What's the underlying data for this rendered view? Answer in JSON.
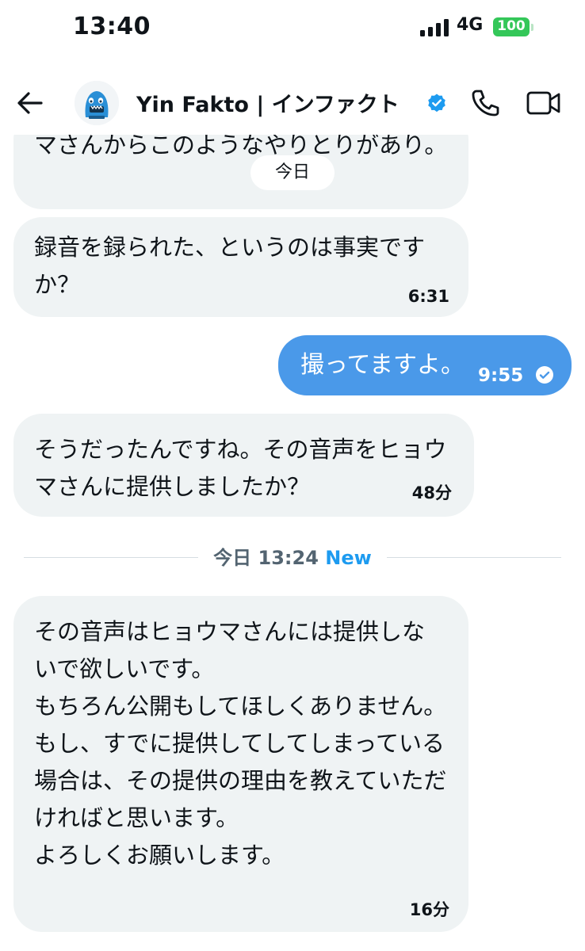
{
  "status_bar": {
    "time": "13:40",
    "network": "4G",
    "battery": "100"
  },
  "header": {
    "contact_name": "Yin Fakto | インファクト"
  },
  "date_pill": "今日",
  "messages": [
    {
      "side": "in",
      "text": "マさんからこのようなやりとりがあり。",
      "time": ""
    },
    {
      "side": "in",
      "text": "録音を録られた、というのは事実ですか？",
      "time": "6:31"
    },
    {
      "side": "out",
      "text": "撮ってますよ。",
      "time": "9:55"
    },
    {
      "side": "in",
      "text": "そうだったんですね。その音声をヒョウマさんに提供しましたか？",
      "time": "48分"
    },
    {
      "side": "in",
      "text": "その音声はヒョウマさんには提供しないで欲しいです。\nもちろん公開もしてほしくありません。\nもし、すでに提供してしてしまっている場合は、その提供の理由を教えていただければと思います。\nよろしくお願いします。",
      "time": "16分"
    }
  ],
  "divider": {
    "label": "今日 13:24",
    "new_label": "New"
  }
}
